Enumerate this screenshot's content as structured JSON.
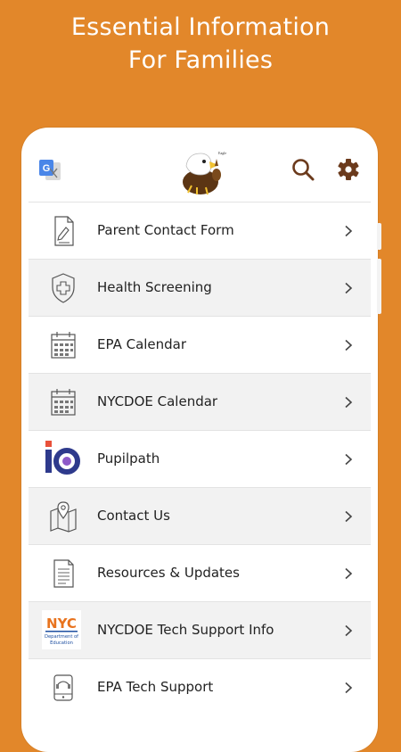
{
  "headline": {
    "line1": "Essential Information",
    "line2": "For Families"
  },
  "colors": {
    "background": "#E2872A",
    "icon_brown": "#6B3A1C",
    "text": "#222222"
  },
  "topbar": {
    "icons": [
      "translate-icon",
      "school-logo",
      "search-icon",
      "gear-icon"
    ]
  },
  "menu": {
    "items": [
      {
        "label": "Parent Contact Form",
        "icon": "form-icon"
      },
      {
        "label": "Health Screening",
        "icon": "health-shield-icon"
      },
      {
        "label": "EPA Calendar",
        "icon": "calendar-icon"
      },
      {
        "label": "NYCDOE Calendar",
        "icon": "calendar-icon"
      },
      {
        "label": "Pupilpath",
        "icon": "pupilpath-logo-icon"
      },
      {
        "label": "Contact Us",
        "icon": "map-icon"
      },
      {
        "label": "Resources & Updates",
        "icon": "document-icon"
      },
      {
        "label": "NYCDOE Tech Support Info",
        "icon": "nyc-doe-logo-icon"
      },
      {
        "label": "EPA Tech Support",
        "icon": "tech-support-icon"
      }
    ]
  }
}
